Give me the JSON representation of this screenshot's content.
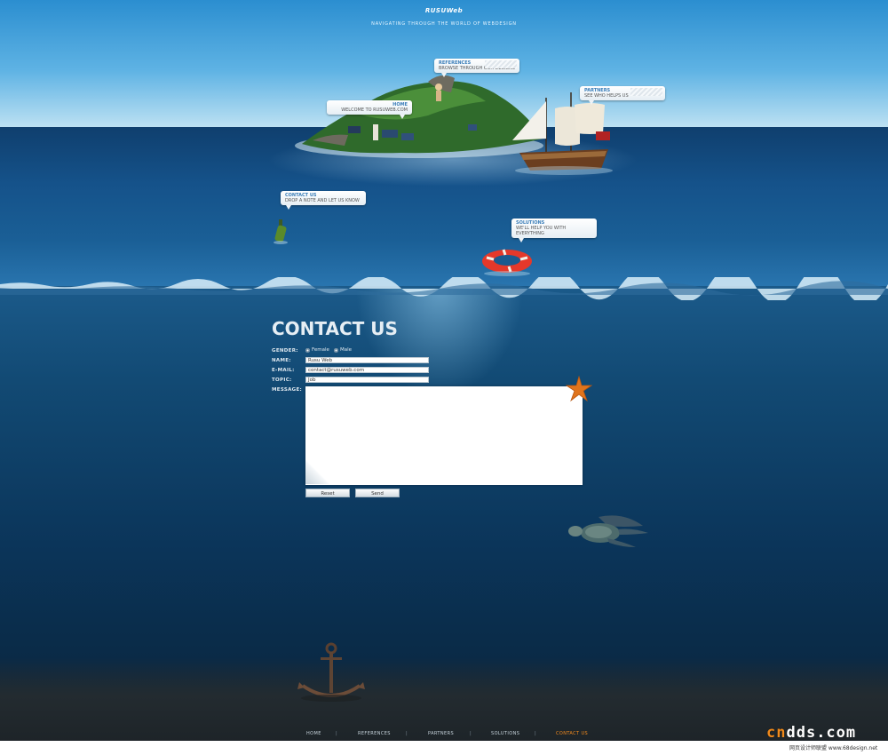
{
  "header": {
    "logo_text": "RUSUWeb",
    "tagline": "NAVIGATING THROUGH THE WORLD OF WEBDESIGN"
  },
  "bubbles": {
    "references": {
      "title": "REFERENCES",
      "sub": "BROWSE THROUGH OUR DESIGNS"
    },
    "partners": {
      "title": "PARTNERS",
      "sub": "SEE WHO HELPS US"
    },
    "home": {
      "title": "HOME",
      "sub": "WELCOME TO RUSUWEB.COM"
    },
    "contact": {
      "title": "CONTACT US",
      "sub": "DROP A NOTE AND LET US KNOW"
    },
    "solutions": {
      "title": "SOLUTIONS",
      "sub": "WE'LL HELP YOU WITH EVERYTHING"
    }
  },
  "form": {
    "title": "CONTACT US",
    "gender_label": "GENDER:",
    "gender_options": [
      "Female",
      "Male"
    ],
    "name_label": "NAME:",
    "name_value": "Rusu Web",
    "email_label": "E-MAIL:",
    "email_value": "contact@rusuweb.com",
    "topic_label": "TOPIC:",
    "topic_value": "Job",
    "message_label": "MESSAGE:",
    "message_value": "",
    "reset_label": "Reset",
    "send_label": "Send"
  },
  "nav": {
    "items": [
      "HOME",
      "REFERENCES",
      "PARTNERS",
      "SOLUTIONS",
      "CONTACT US"
    ],
    "active": "CONTACT US"
  },
  "watermark": {
    "text_c": "cn",
    "text_rest": "dds.com",
    "sub": "网页设计师联盟 www.68design.net"
  },
  "colors": {
    "sky": "#5fb3e4",
    "sea": "#15528a",
    "accent": "#f28a1e",
    "bubble_title": "#3a7db8"
  }
}
